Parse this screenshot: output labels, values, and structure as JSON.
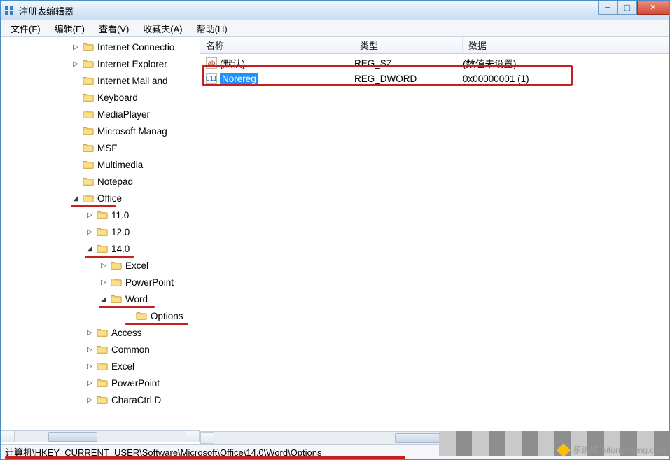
{
  "window": {
    "title": "注册表编辑器"
  },
  "menu": {
    "file": "文件(F)",
    "edit": "编辑(E)",
    "view": "查看(V)",
    "favorites": "收藏夫(A)",
    "help": "帮助(H)"
  },
  "tree": {
    "nodes": [
      {
        "indent": 100,
        "exp": "▷",
        "label": "Internet Connectio"
      },
      {
        "indent": 100,
        "exp": "▷",
        "label": "Internet Explorer"
      },
      {
        "indent": 100,
        "exp": "",
        "label": "Internet Mail and"
      },
      {
        "indent": 100,
        "exp": "",
        "label": "Keyboard"
      },
      {
        "indent": 100,
        "exp": "",
        "label": "MediaPlayer"
      },
      {
        "indent": 100,
        "exp": "",
        "label": "Microsoft Manag"
      },
      {
        "indent": 100,
        "exp": "",
        "label": "MSF"
      },
      {
        "indent": 100,
        "exp": "",
        "label": "Multimedia"
      },
      {
        "indent": 100,
        "exp": "",
        "label": "Notepad"
      },
      {
        "indent": 100,
        "exp": "◢",
        "label": "Office",
        "mark": true,
        "markL": 100,
        "markW": 65
      },
      {
        "indent": 120,
        "exp": "▷",
        "label": "11.0"
      },
      {
        "indent": 120,
        "exp": "▷",
        "label": "12.0"
      },
      {
        "indent": 120,
        "exp": "◢",
        "label": "14.0",
        "mark": true,
        "markL": 120,
        "markW": 70
      },
      {
        "indent": 140,
        "exp": "▷",
        "label": "Excel"
      },
      {
        "indent": 140,
        "exp": "▷",
        "label": "PowerPoint"
      },
      {
        "indent": 140,
        "exp": "◢",
        "label": "Word",
        "mark": true,
        "markL": 140,
        "markW": 80
      },
      {
        "indent": 176,
        "exp": "",
        "label": "Options",
        "mark": true,
        "markL": 178,
        "markW": 90
      },
      {
        "indent": 120,
        "exp": "▷",
        "label": "Access"
      },
      {
        "indent": 120,
        "exp": "▷",
        "label": "Common"
      },
      {
        "indent": 120,
        "exp": "▷",
        "label": "Excel"
      },
      {
        "indent": 120,
        "exp": "▷",
        "label": "PowerPoint"
      },
      {
        "indent": 120,
        "exp": "▷",
        "label": "CharaCtrl D"
      }
    ]
  },
  "columns": {
    "name": "名称",
    "type": "类型",
    "data": "数据"
  },
  "values": [
    {
      "icon": "sz",
      "name": "(默认)",
      "type": "REG_SZ",
      "data": "(数值未设置)",
      "selected": false
    },
    {
      "icon": "bin",
      "name": "Norereg",
      "type": "REG_DWORD",
      "data": "0x00000001 (1)",
      "selected": true
    }
  ],
  "statusbar": {
    "path": "计算机\\HKEY_CURRENT_USER\\Software\\Microsoft\\Office\\14.0\\Word\\Options"
  },
  "watermark": {
    "brand": "系统城",
    "site": "xitongcheng.com"
  }
}
